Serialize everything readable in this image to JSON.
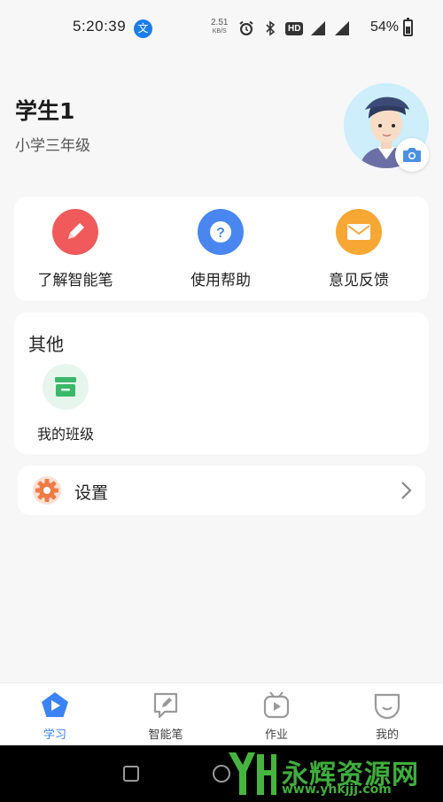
{
  "status_bar": {
    "time": "5:20:39",
    "app_badge": "文",
    "net_speed_value": "2.51",
    "net_speed_unit": "KB/S",
    "hd": "HD",
    "battery": "54%"
  },
  "profile": {
    "name": "学生1",
    "grade": "小学三年级"
  },
  "tools": [
    {
      "label": "了解智能笔",
      "icon": "pencil-icon",
      "color": "#f05a5a"
    },
    {
      "label": "使用帮助",
      "icon": "question-icon",
      "color": "#4a86f0"
    },
    {
      "label": "意见反馈",
      "icon": "mail-icon",
      "color": "#f7a733"
    }
  ],
  "other": {
    "title": "其他",
    "items": [
      {
        "label": "我的班级",
        "icon": "class-box-icon",
        "color": "#3bb86a"
      }
    ]
  },
  "settings": {
    "label": "设置",
    "icon": "gear-icon",
    "color": "#f07a45"
  },
  "tabbar": {
    "tabs": [
      {
        "label": "学习",
        "icon": "play-pentagon-icon",
        "active": true
      },
      {
        "label": "智能笔",
        "icon": "pen-note-icon",
        "active": false
      },
      {
        "label": "作业",
        "icon": "tv-play-icon",
        "active": false
      },
      {
        "label": "我的",
        "icon": "smile-face-icon",
        "active": false
      }
    ],
    "active_color": "#3b82f6"
  },
  "watermark": {
    "text": "永辉资源网",
    "url": "www.yhkjjj.com"
  }
}
